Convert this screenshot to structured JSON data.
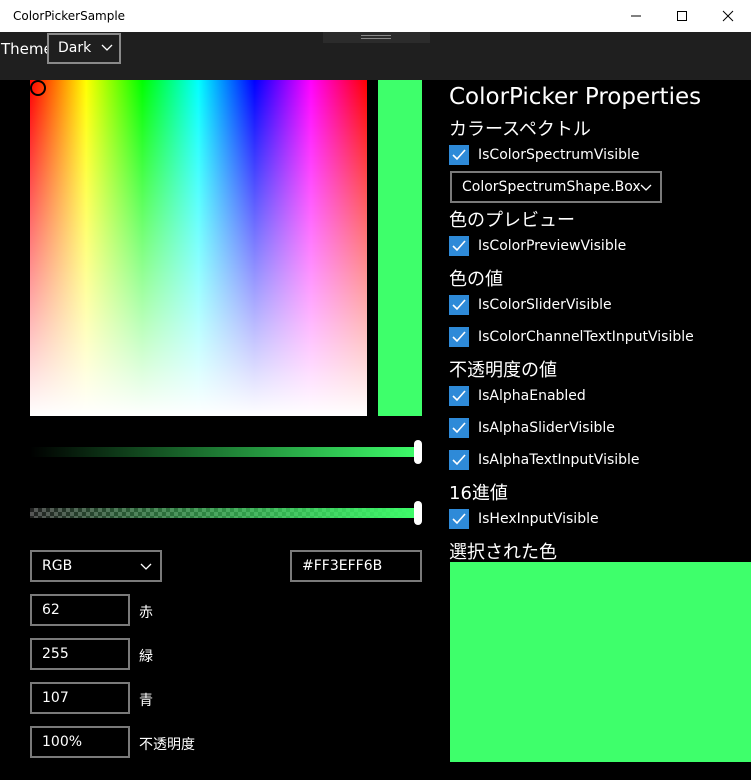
{
  "window": {
    "title": "ColorPickerSample",
    "controls": {
      "minimize": "minimize-icon",
      "maximize": "maximize-icon",
      "close": "close-icon"
    }
  },
  "topbar": {
    "theme_label": "Theme",
    "theme_value": "Dark"
  },
  "colors": {
    "selected": "#3eff6b",
    "accent": "#2e8ad8"
  },
  "picker": {
    "mode_value": "RGB",
    "hex_value": "#FF3EFF6B",
    "channels": [
      {
        "value": "62",
        "label": "赤"
      },
      {
        "value": "255",
        "label": "緑"
      },
      {
        "value": "107",
        "label": "青"
      },
      {
        "value": "100%",
        "label": "不透明度"
      }
    ],
    "value_slider_level": 1.0,
    "alpha_slider_level": 1.0
  },
  "properties": {
    "title": "ColorPicker Properties",
    "spectrum_heading": "カラースペクトル",
    "spectrum_visible": "IsColorSpectrumVisible",
    "spectrum_shape": "ColorSpectrumShape.Box",
    "preview_heading": "色のプレビュー",
    "preview_visible": "IsColorPreviewVisible",
    "value_heading": "色の値",
    "slider_visible": "IsColorSliderVisible",
    "channel_input_visible": "IsColorChannelTextInputVisible",
    "alpha_heading": "不透明度の値",
    "alpha_enabled": "IsAlphaEnabled",
    "alpha_slider_visible": "IsAlphaSliderVisible",
    "alpha_text_visible": "IsAlphaTextInputVisible",
    "hex_heading": "16進値",
    "hex_visible": "IsHexInputVisible",
    "selected_heading": "選択された色"
  }
}
